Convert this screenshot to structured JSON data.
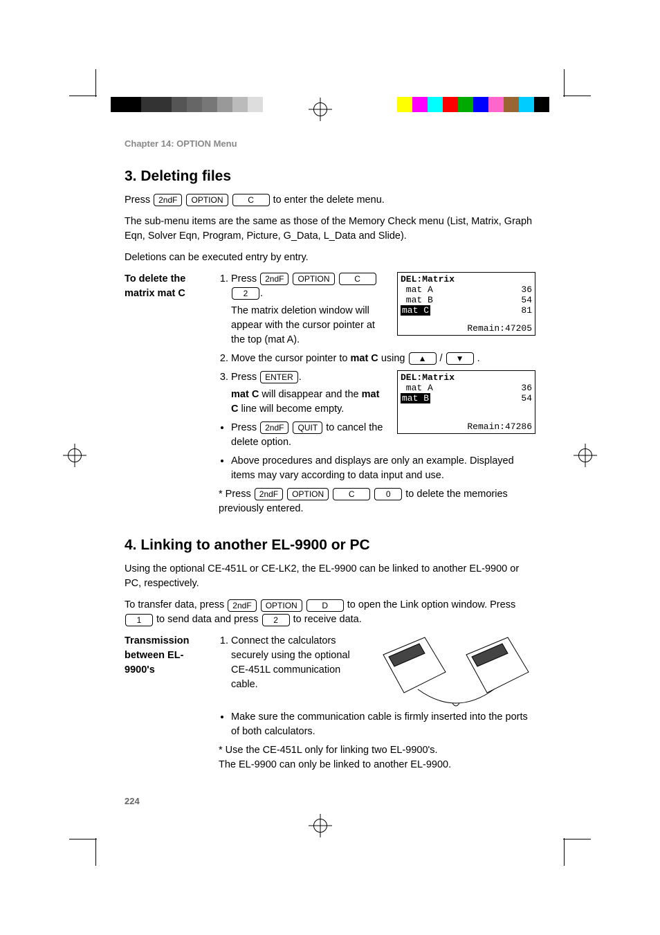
{
  "chapter": "Chapter 14: OPTION Menu",
  "section3": {
    "title": "3. Deleting files",
    "intro_parts": [
      "Press ",
      " to enter the delete menu."
    ],
    "para1": "The sub-menu items are the same as those of the Memory Check menu (List, Matrix, Graph Eqn, Solver Eqn, Program, Picture, G_Data, L_Data and Slide).",
    "para2": "Deletions can be executed entry by entry.",
    "sidehead": "To delete the matrix mat C",
    "step1_parts": [
      "Press ",
      "."
    ],
    "step1_after": "The matrix deletion window will appear with the cursor pointer at the top (mat A).",
    "step2_parts": [
      "Move the cursor pointer to ",
      "mat C",
      " using ",
      " / ",
      "."
    ],
    "step3_parts": [
      "Press ",
      "."
    ],
    "step3_after_parts": [
      "",
      "mat C",
      " will disappear and the ",
      "mat C",
      " line will become empty."
    ],
    "bullet_cancel_parts": [
      "Press ",
      " to cancel the delete option."
    ],
    "bullet_note": "Above procedures and displays are only an example. Displayed items may vary according to data input and use.",
    "star_parts": [
      "Press ",
      " to delete the memories previously entered."
    ]
  },
  "keys": {
    "secondF": "2ndF",
    "option": "OPTION",
    "C": "C",
    "D": "D",
    "two": "2",
    "zero": "0",
    "one": "1",
    "enter": "ENTER",
    "quit": "QUIT",
    "up": "▲",
    "down": "▼"
  },
  "lcd1": {
    "title": "DEL:Matrix",
    "rows": [
      {
        "name": " mat A",
        "val": "36"
      },
      {
        "name": " mat B",
        "val": "54"
      },
      {
        "name_inv": "mat C",
        "val": "81"
      }
    ],
    "remain": "Remain:47205"
  },
  "lcd2": {
    "title": "DEL:Matrix",
    "rows": [
      {
        "name": " mat A",
        "val": "36"
      },
      {
        "name_inv": "mat B",
        "val": "54"
      }
    ],
    "remain": "Remain:47286"
  },
  "section4": {
    "title": "4. Linking to another EL-9900 or PC",
    "para1": "Using the optional CE-451L or CE-LK2, the EL-9900 can be linked to another EL-9900 or PC, respectively.",
    "transfer_parts": [
      "To transfer data, press ",
      " to open the Link option window. Press ",
      " to send data and press ",
      " to receive data."
    ],
    "sidehead": "Transmission between EL-9900's",
    "step1": "Connect the calculators securely using the optional CE-451L communication cable.",
    "bullet": "Make sure the communication cable is firmly inserted into the ports of both calculators.",
    "star1": "Use the CE-451L only for linking two EL-9900's.",
    "star2": "The EL-9900 can only be linked to another EL-9900."
  },
  "pagenum": "224",
  "colors_left": [
    "#000",
    "#000",
    "#333",
    "#333",
    "#555",
    "#666",
    "#777",
    "#999",
    "#bbb",
    "#ddd"
  ],
  "colors_right": [
    "#ffff00",
    "#ff00ff",
    "#00ffff",
    "#ff0000",
    "#00aa00",
    "#0000ff",
    "#ff66cc",
    "#996633",
    "#00ccff",
    "#000"
  ]
}
